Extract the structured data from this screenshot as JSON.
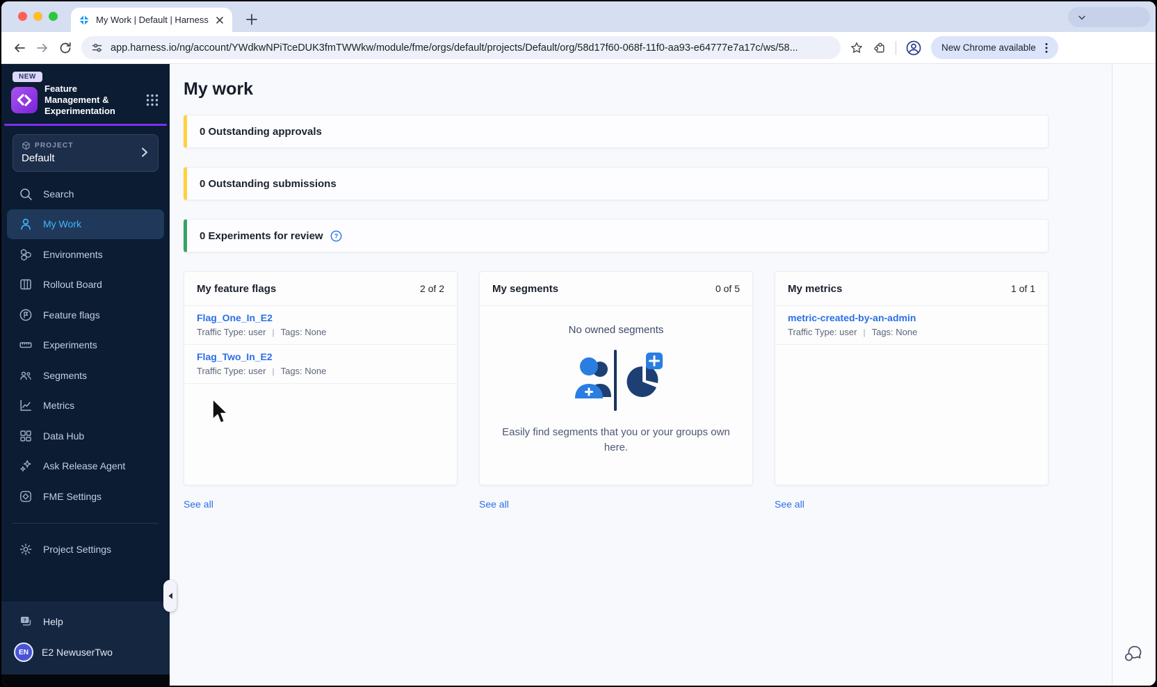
{
  "browser": {
    "tab_title": "My Work | Default | Harness",
    "url": "app.harness.io/ng/account/YWdkwNPiTceDUK3fmTWWkw/module/fme/orgs/default/projects/Default/org/58d17f60-068f-11f0-aa93-e64777e7a17c/ws/58...",
    "update_button": "New Chrome available"
  },
  "sidebar": {
    "badge": "NEW",
    "app_title": "Feature Management & Experimentation",
    "project": {
      "label": "PROJECT",
      "name": "Default"
    },
    "items": [
      {
        "label": "Search"
      },
      {
        "label": "My Work",
        "selected": true
      },
      {
        "label": "Environments"
      },
      {
        "label": "Rollout Board"
      },
      {
        "label": "Feature flags"
      },
      {
        "label": "Experiments"
      },
      {
        "label": "Segments"
      },
      {
        "label": "Metrics"
      },
      {
        "label": "Data Hub"
      },
      {
        "label": "Ask Release Agent"
      },
      {
        "label": "FME Settings"
      }
    ],
    "project_settings": "Project Settings",
    "help": "Help",
    "user": {
      "initials": "EN",
      "name": "E2 NewuserTwo"
    }
  },
  "main": {
    "title": "My work",
    "meta_separator": "|",
    "alerts": [
      {
        "text": "0 Outstanding approvals",
        "accent": "#ffd040",
        "has_help": false
      },
      {
        "text": "0 Outstanding submissions",
        "accent": "#ffd040",
        "has_help": false
      },
      {
        "text": "0 Experiments for review",
        "accent": "#37a266",
        "has_help": true
      }
    ],
    "cards": [
      {
        "title": "My feature flags",
        "count": "2 of 2",
        "see_all": "See all",
        "items": [
          {
            "name": "Flag_One_In_E2",
            "traffic": "Traffic Type: user",
            "tags": "Tags: None"
          },
          {
            "name": "Flag_Two_In_E2",
            "traffic": "Traffic Type: user",
            "tags": "Tags: None"
          }
        ]
      },
      {
        "title": "My segments",
        "count": "0 of 5",
        "see_all": "See all",
        "empty": {
          "title": "No owned segments",
          "description": "Easily find segments that you or your groups own here."
        }
      },
      {
        "title": "My metrics",
        "count": "1 of 1",
        "see_all": "See all",
        "items": [
          {
            "name": "metric-created-by-an-admin",
            "traffic": "Traffic Type: user",
            "tags": "Tags: None"
          }
        ]
      }
    ]
  },
  "colors": {
    "alert_yellow": "#ffd040",
    "alert_green": "#37a266",
    "link_blue": "#2a6fe8",
    "sidebar_selected": "#41b6ff",
    "sidebar_bg": "#0b1c33",
    "brand_purple": "#7d2ff2"
  }
}
